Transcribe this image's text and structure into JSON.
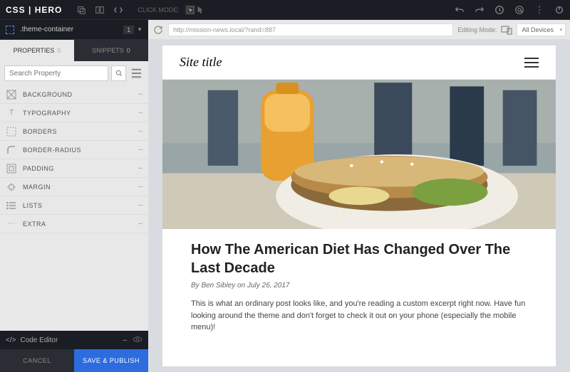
{
  "logo": "CSS | HERO",
  "click_mode_label": "CLICK MODE:",
  "selector": ".theme-container",
  "selector_count": "1",
  "tabs": {
    "properties": {
      "label": "PROPERTIES",
      "count": "0"
    },
    "snippets": {
      "label": "SNIPPETS",
      "count": "0"
    }
  },
  "search_placeholder": "Search Property",
  "properties": [
    {
      "label": "BACKGROUND"
    },
    {
      "label": "TYPOGRAPHY"
    },
    {
      "label": "BORDERS"
    },
    {
      "label": "BORDER-RADIUS"
    },
    {
      "label": "PADDING"
    },
    {
      "label": "MARGIN"
    },
    {
      "label": "LISTS"
    },
    {
      "label": "EXTRA"
    }
  ],
  "code_editor_label": "Code Editor",
  "cancel_label": "CANCEL",
  "publish_label": "SAVE & PUBLISH",
  "url": "http://mission-news.local/?rand=887",
  "editing_mode_label": "Editing Mode:",
  "device_selected": "All Devices",
  "site": {
    "title": "Site title",
    "article_title": "How The American Diet Has Changed Over The Last Decade",
    "by": "By",
    "author": "Ben Sibley",
    "on": "on",
    "date": "July 26, 2017",
    "excerpt": "This is what an ordinary post looks like, and you're reading a custom excerpt right now. Have fun looking around the theme and don't forget to check it out on your phone (especially the mobile menu)!"
  }
}
